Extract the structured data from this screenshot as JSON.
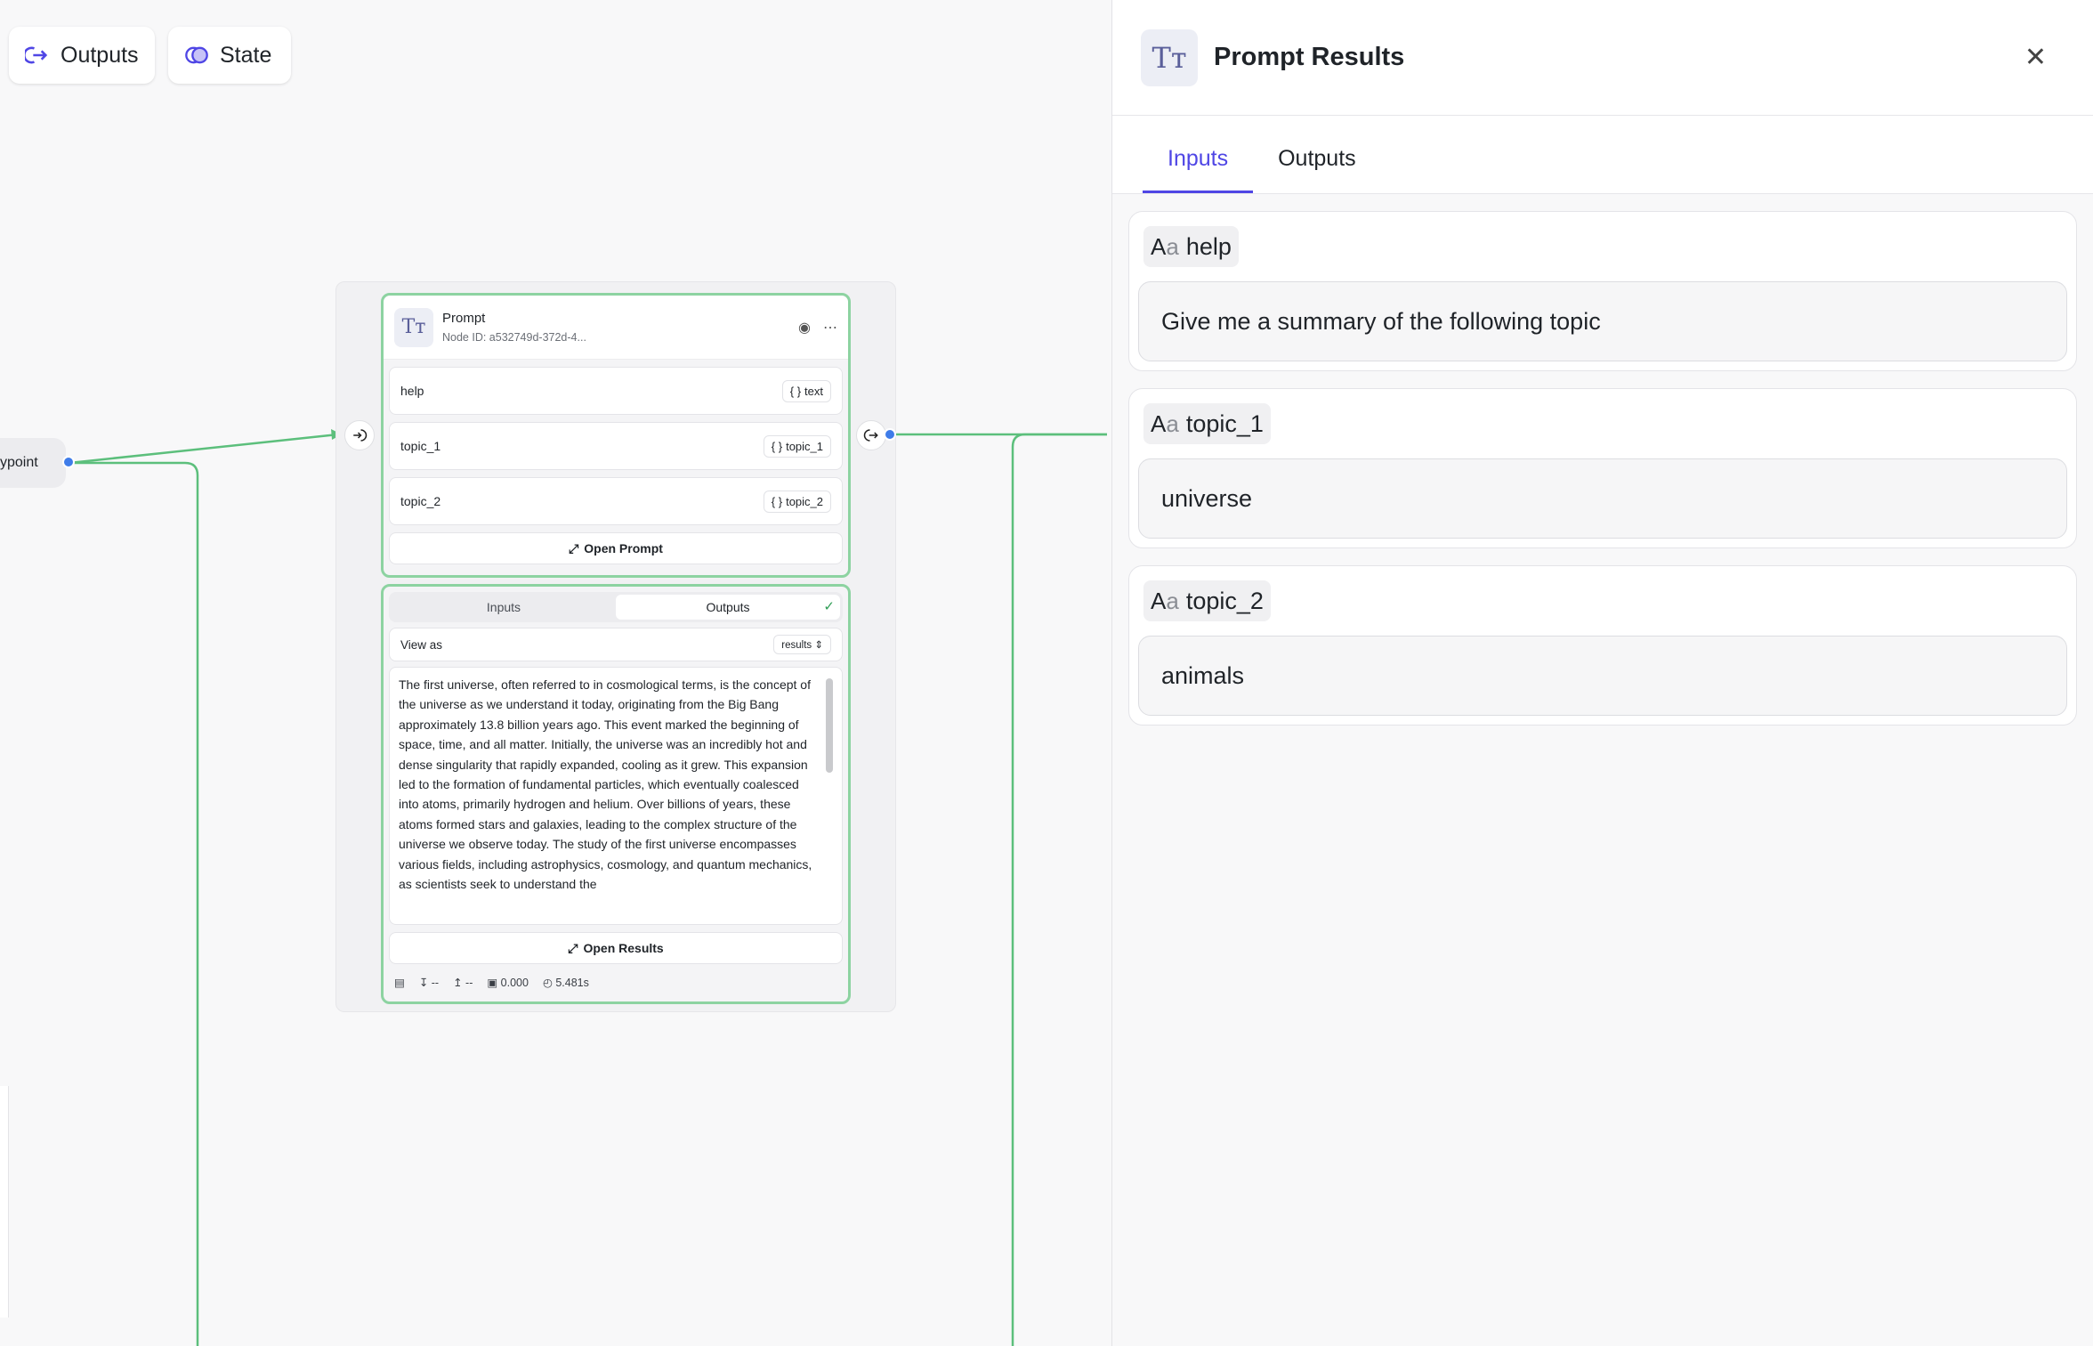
{
  "toolbar": {
    "outputs_label": "Outputs",
    "state_label": "State"
  },
  "canvas": {
    "entry_node_label": "ypoint",
    "prompt_node": {
      "title": "Prompt",
      "node_id": "Node ID:  a532749d-372d-4...",
      "params": [
        {
          "name": "help",
          "tag": "text"
        },
        {
          "name": "topic_1",
          "tag": "topic_1"
        },
        {
          "name": "topic_2",
          "tag": "topic_2"
        }
      ],
      "open_button": "Open Prompt"
    },
    "results_node": {
      "tab_inputs": "Inputs",
      "tab_outputs": "Outputs",
      "view_as_label": "View as",
      "view_as_value": "results",
      "result_text": "The first universe, often referred to in cosmological terms, is the concept of the universe as we understand it today, originating from the Big Bang approximately 13.8 billion years ago. This event marked the beginning of space, time, and all matter. Initially, the universe was an incredibly hot and dense singularity that rapidly expanded, cooling as it grew. This expansion led to the formation of fundamental particles, which eventually coalesced into atoms, primarily hydrogen and helium. Over billions of years, these atoms formed stars and galaxies, leading to the complex structure of the universe we observe today. The study of the first universe encompasses various fields, including astrophysics, cosmology, and quantum mechanics, as scientists seek to understand the",
      "open_button": "Open Results",
      "stats": {
        "tokens_in": "--",
        "tokens_out": "--",
        "cost": "0.000",
        "time": "5.481s"
      }
    }
  },
  "panel": {
    "title": "Prompt Results",
    "tabs": [
      "Inputs",
      "Outputs"
    ],
    "active_tab": "Inputs",
    "fields": [
      {
        "label": "help",
        "value": "Give me a summary of the following topic"
      },
      {
        "label": "topic_1",
        "value": "universe"
      },
      {
        "label": "topic_2",
        "value": "animals"
      }
    ]
  },
  "colors": {
    "accent": "#4f46e5",
    "edge_green": "#5cbf7c",
    "port_blue": "#3f7ce9",
    "node_border": "#8dd3a1"
  }
}
